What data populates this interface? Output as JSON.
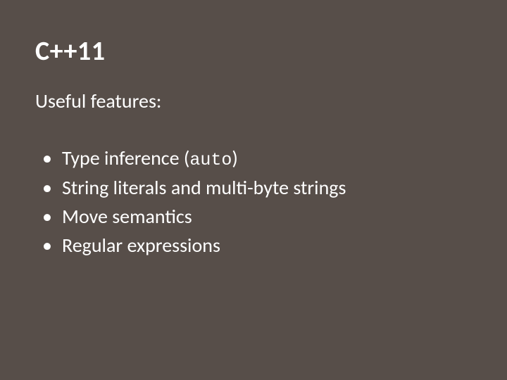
{
  "title": "C++11",
  "subtitle": "Useful features:",
  "bullets": [
    {
      "prefix": "Type inference (",
      "code": "auto",
      "suffix": ")"
    },
    {
      "text": "String literals and multi-byte strings"
    },
    {
      "text": "Move semantics"
    },
    {
      "text": "Regular expressions"
    }
  ]
}
